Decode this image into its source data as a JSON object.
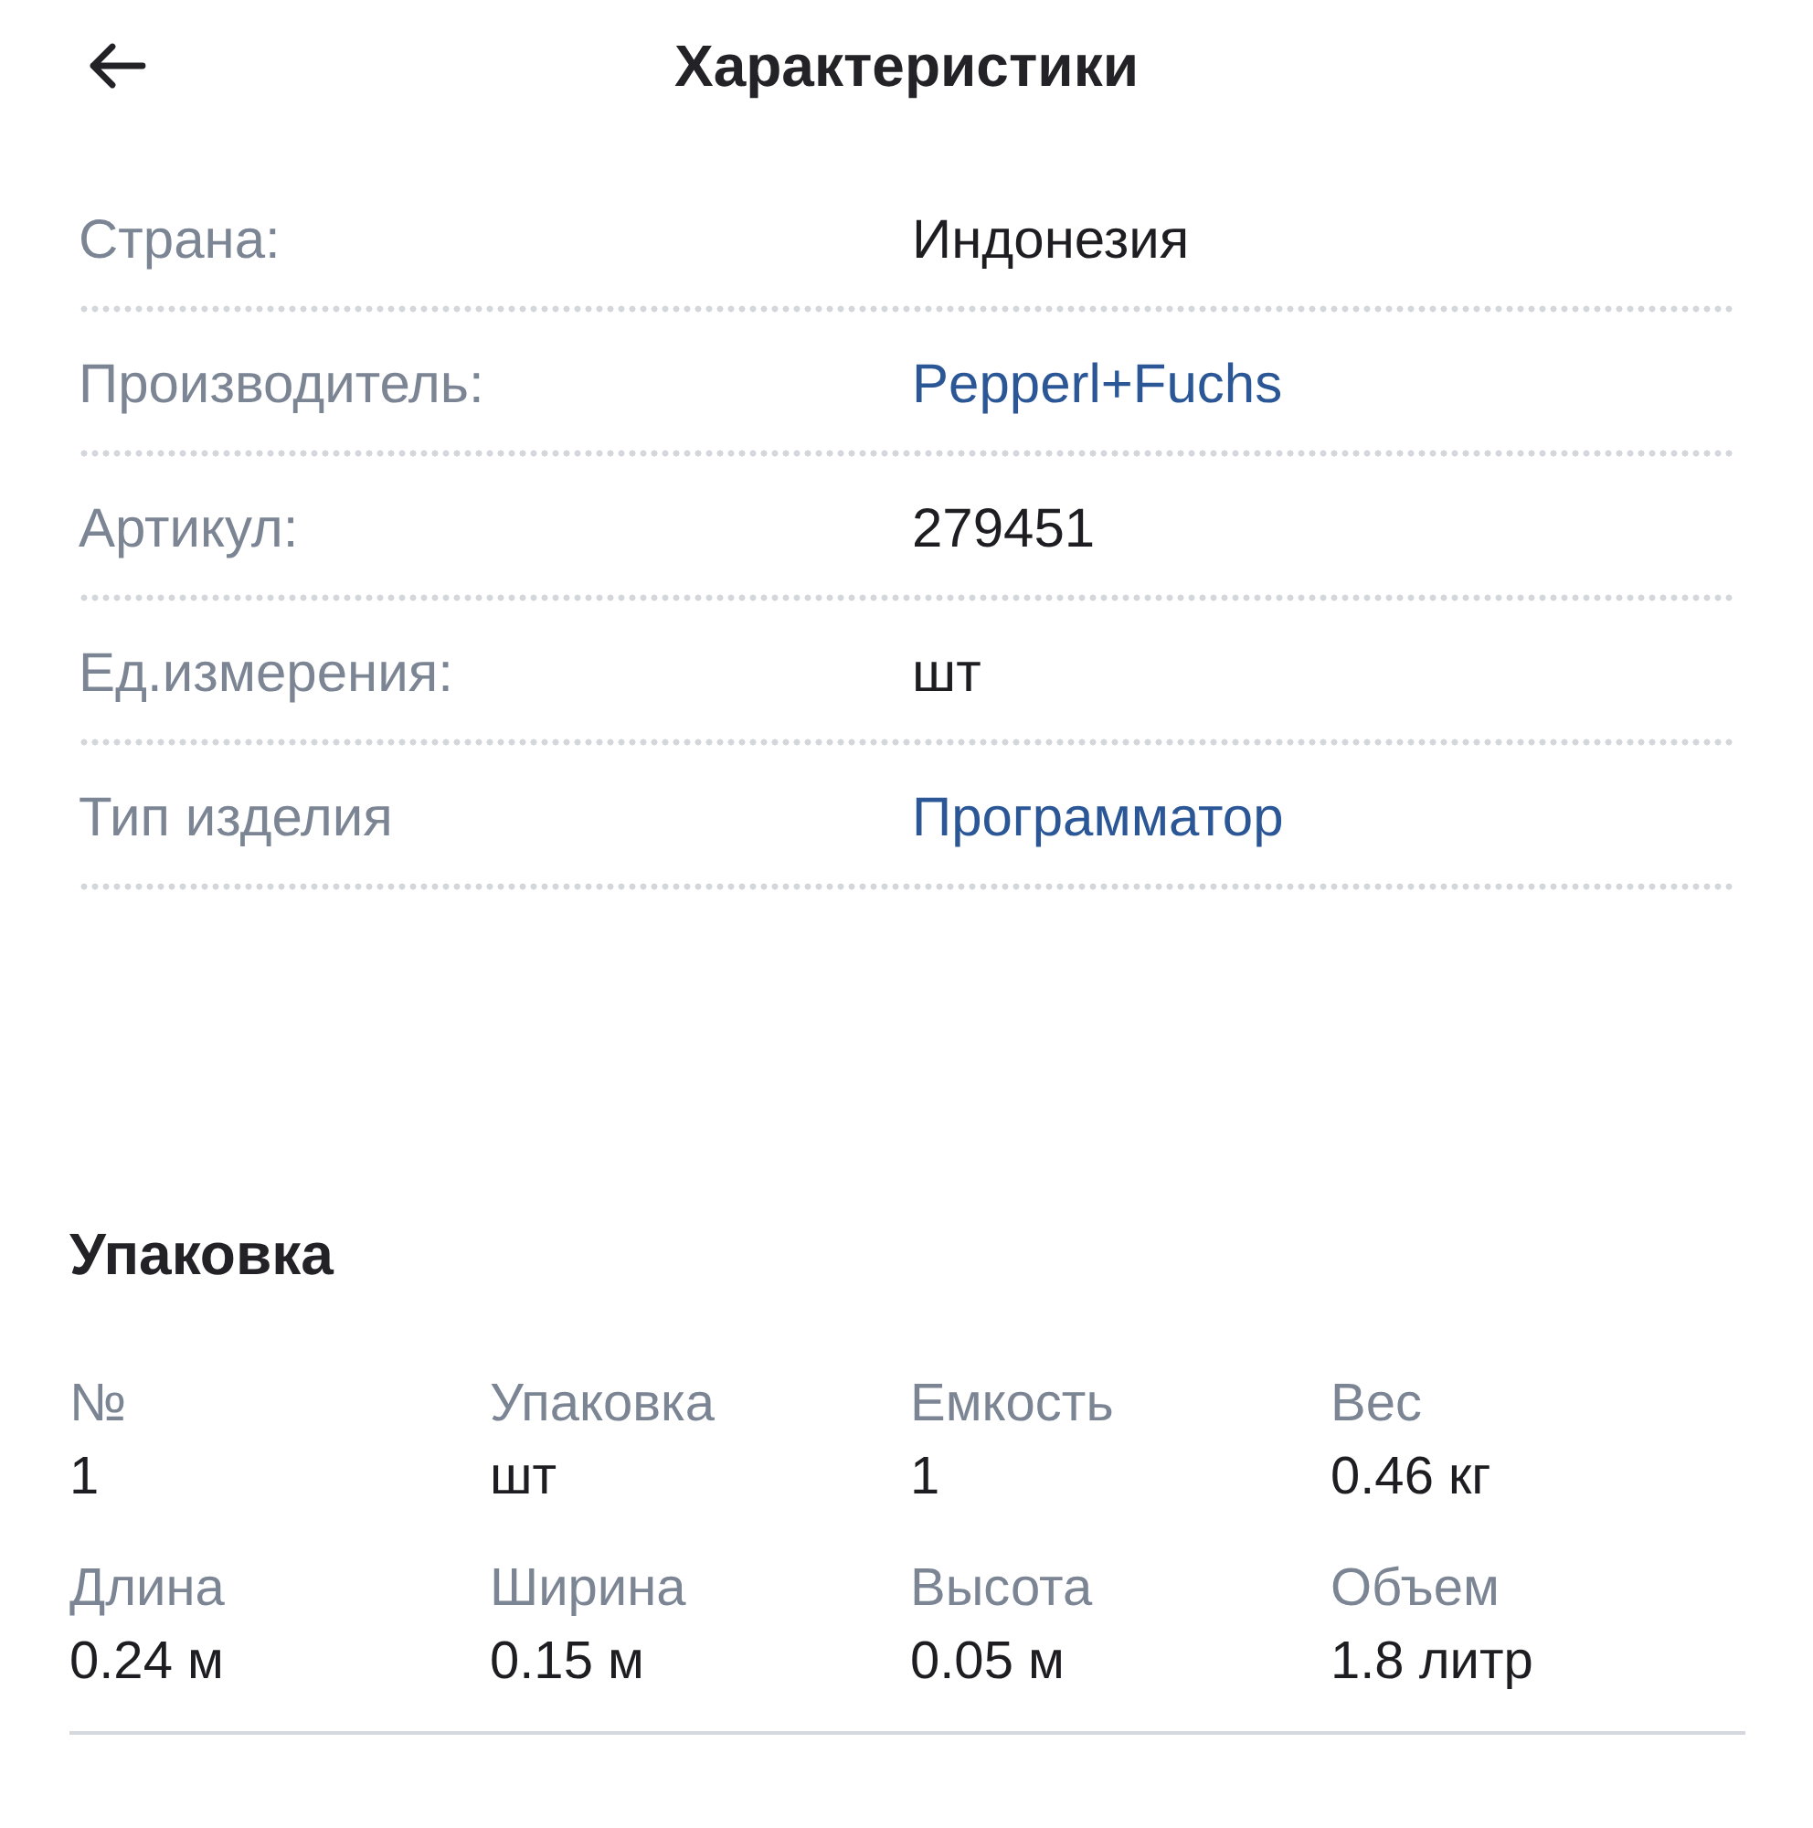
{
  "header": {
    "title": "Характеристики"
  },
  "characteristics": [
    {
      "label": "Страна:",
      "value": "Индонезия",
      "kind": "text"
    },
    {
      "label": "Производитель:",
      "value": "Pepperl+Fuchs",
      "kind": "link"
    },
    {
      "label": "Артикул:",
      "value": "279451",
      "kind": "text"
    },
    {
      "label": "Ед.измерения:",
      "value": "шт",
      "kind": "text"
    },
    {
      "label": "Тип изделия",
      "value": "Программатор",
      "kind": "link"
    }
  ],
  "packaging": {
    "title": "Упаковка",
    "fields": [
      {
        "label": "№",
        "value": "1"
      },
      {
        "label": "Упаковка",
        "value": "шт"
      },
      {
        "label": "Емкость",
        "value": "1"
      },
      {
        "label": "Вес",
        "value": "0.46 кг"
      },
      {
        "label": "Длина",
        "value": "0.24 м"
      },
      {
        "label": "Ширина",
        "value": "0.15 м"
      },
      {
        "label": "Высота",
        "value": "0.05 м"
      },
      {
        "label": "Объем",
        "value": "1.8 литр"
      }
    ]
  }
}
